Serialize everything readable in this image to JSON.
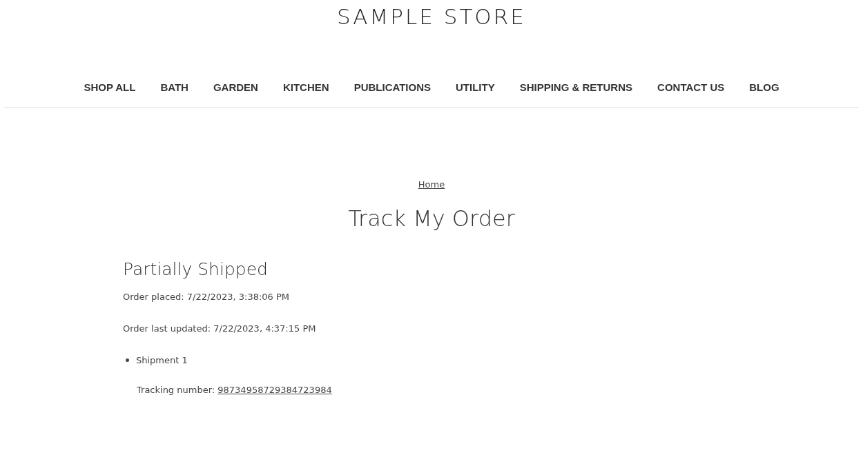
{
  "store_name": "SAMPLE STORE",
  "nav": [
    "SHOP ALL",
    "BATH",
    "GARDEN",
    "KITCHEN",
    "PUBLICATIONS",
    "UTILITY",
    "SHIPPING & RETURNS",
    "CONTACT US",
    "BLOG"
  ],
  "breadcrumb": "Home",
  "page_title": "Track My Order",
  "order": {
    "status": "Partially Shipped",
    "placed": "Order placed: 7/22/2023, 3:38:06 PM",
    "updated": "Order last updated: 7/22/2023, 4:37:15 PM",
    "shipments": [
      {
        "name": "Shipment 1",
        "tracking_label": "Tracking number:",
        "tracking_number": "98734958729384723984"
      }
    ]
  }
}
